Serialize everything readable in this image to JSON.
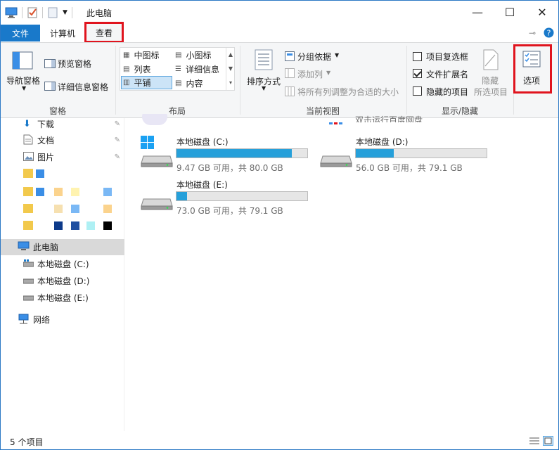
{
  "window": {
    "title": "此电脑",
    "minimize": "—",
    "maximize": "☐",
    "close": "✕"
  },
  "tabs": {
    "file": "文件",
    "computer": "计算机",
    "view": "查看"
  },
  "ribbon": {
    "panes": {
      "label": "窗格",
      "nav_pane": "导航窗格",
      "preview_pane": "预览窗格",
      "details_pane": "详细信息窗格"
    },
    "layout": {
      "label": "布局",
      "medium_icons": "中图标",
      "small_icons": "小图标",
      "list": "列表",
      "details": "详细信息",
      "tiles": "平铺",
      "content": "内容"
    },
    "current_view": {
      "label": "当前视图",
      "sort_by": "排序方式",
      "group_by": "分组依据",
      "add_columns": "添加列",
      "size_columns": "将所有列调整为合适的大小"
    },
    "show_hide": {
      "label": "显示/隐藏",
      "item_checkboxes": "项目复选框",
      "file_extensions": "文件扩展名",
      "hidden_items": "隐藏的项目",
      "hide_selected_line1": "隐藏",
      "hide_selected_line2": "所选项目",
      "item_checkboxes_checked": false,
      "file_extensions_checked": true,
      "hidden_items_checked": false
    },
    "options": "选项"
  },
  "nav": {
    "downloads": "下载",
    "documents": "文档",
    "pictures": "图片",
    "this_pc": "此电脑",
    "drive_c": "本地磁盘 (C:)",
    "drive_d": "本地磁盘 (D:)",
    "drive_e": "本地磁盘 (E:)",
    "network": "网络"
  },
  "content": {
    "partial_app_text": "双击运行百度网盘",
    "drives": [
      {
        "name": "本地磁盘 (C:)",
        "info": "9.47 GB 可用，共 80.0 GB",
        "used_fraction": 0.88
      },
      {
        "name": "本地磁盘 (D:)",
        "info": "56.0 GB 可用，共 79.1 GB",
        "used_fraction": 0.29
      },
      {
        "name": "本地磁盘 (E:)",
        "info": "73.0 GB 可用，共 79.1 GB",
        "used_fraction": 0.08
      }
    ]
  },
  "status": {
    "item_count": "5 个项目"
  },
  "colors": {
    "accent": "#1979ca",
    "highlight": "#e0141e",
    "drive_bar": "#26a0da"
  }
}
